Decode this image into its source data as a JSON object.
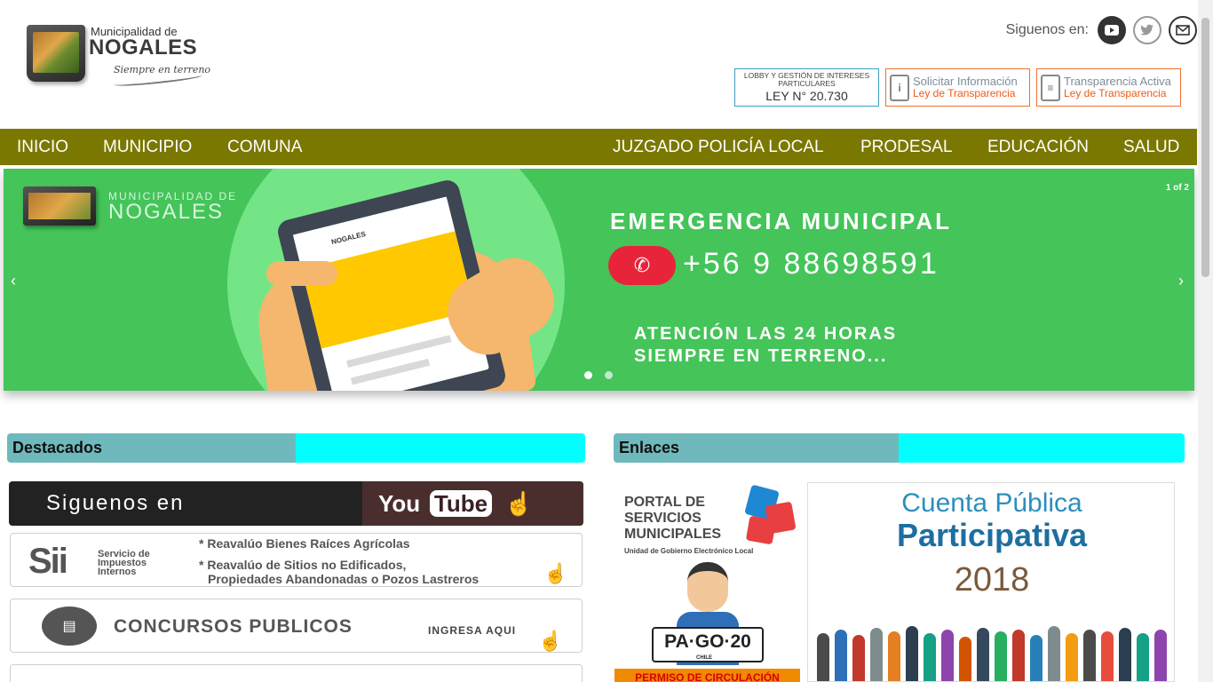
{
  "header": {
    "logo": {
      "top": "Municipalidad de",
      "main": "NOGALES",
      "tagline": "Siempre en terreno"
    },
    "social_label": "Siguenos en:",
    "social_icons": [
      "youtube-icon",
      "twitter-icon",
      "mail-icon"
    ]
  },
  "transparency_links": {
    "lobby": {
      "line1": "LOBBY Y GESTIÓN DE INTERESES",
      "line2": "PARTICULARES",
      "law": "LEY N° 20.730"
    },
    "solicitar": {
      "title": "Solicitar Información",
      "sub": "Ley de Transparencia"
    },
    "activa": {
      "title": "Transparencia Activa",
      "sub": "Ley de Transparencia"
    }
  },
  "nav": {
    "items": [
      "INICIO",
      "MUNICIPIO",
      "COMUNA",
      "JUZGADO POLICÍA LOCAL",
      "PRODESAL",
      "EDUCACIÓN",
      "SALUD"
    ]
  },
  "slider": {
    "counter": "1 of 2",
    "logo_top": "MUNICIPALIDAD DE",
    "logo_main": "NOGALES",
    "phone_header": "NOGALES",
    "heading": "EMERGENCIA MUNICIPAL",
    "phone_number": "+56 9 88698591",
    "line1": "ATENCIÓN LAS 24 HORAS",
    "line2": "SIEMPRE EN TERRENO...",
    "slides_total": 2,
    "active_slide": 1,
    "prev_arrow": "‹",
    "next_arrow": "›"
  },
  "destacados": {
    "title": "Destacados",
    "youtube": {
      "text": "Siguenos en",
      "you": "You",
      "tube": "Tube"
    },
    "sii": {
      "logo": "Sii",
      "name_1": "Servicio de",
      "name_2": "Impuestos",
      "name_3": "Internos",
      "bullet1": "* Reavalúo Bienes Raíces Agrícolas",
      "bullet2a": "* Reavalúo de Sitios no Edificados,",
      "bullet2b": "Propiedades Abandonadas o Pozos Lastreros"
    },
    "concursos": {
      "text": "CONCURSOS PUBLICOS",
      "link": "INGRESA AQUI"
    }
  },
  "enlaces": {
    "title": "Enlaces",
    "portal": {
      "line1": "PORTAL DE",
      "line2": "SERVICIOS",
      "line3": "MUNICIPALES",
      "sub": "Unidad de Gobierno Electrónico Local",
      "plate": "PA·GO·20",
      "plate_sub": "CHILE",
      "banner": "PERMISO DE CIRCULACIÓN"
    },
    "cuenta": {
      "line1": "Cuenta Pública",
      "line2": "Participativa",
      "year": "2018"
    }
  },
  "colors": {
    "nav_bg": "#7a7800",
    "slider_bg": "#44c459",
    "section_left": "#6fb9bd",
    "section_right": "#00ffff",
    "accent_orange": "#ef5a14",
    "accent_blue": "#3a9fc3"
  }
}
